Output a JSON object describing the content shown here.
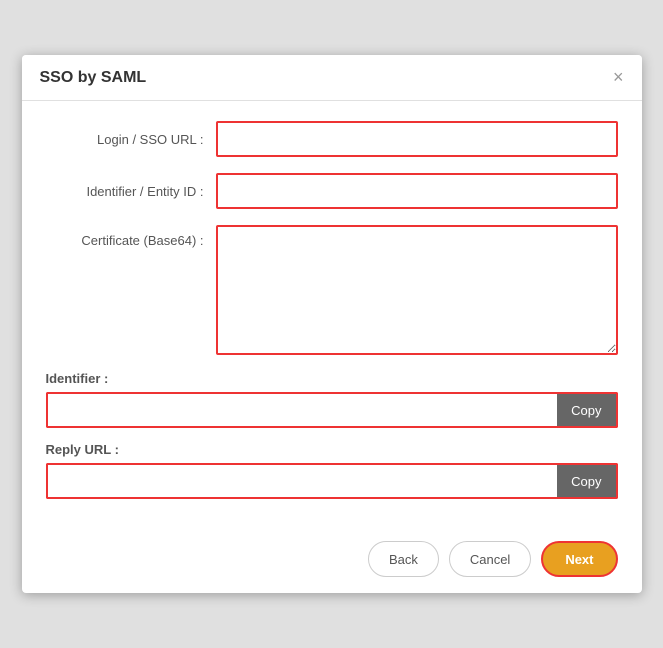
{
  "dialog": {
    "title": "SSO by SAML",
    "close_label": "×"
  },
  "form": {
    "login_sso_url_label": "Login / SSO URL :",
    "login_sso_url_value": "",
    "identifier_entity_id_label": "Identifier / Entity ID :",
    "identifier_entity_id_value": "",
    "certificate_label": "Certificate (Base64) :",
    "certificate_value": "",
    "identifier_section_label": "Identifier :",
    "identifier_copy_value": "",
    "reply_url_section_label": "Reply URL :",
    "reply_url_copy_value": ""
  },
  "buttons": {
    "copy1_label": "Copy",
    "copy2_label": "Copy",
    "back_label": "Back",
    "cancel_label": "Cancel",
    "next_label": "Next"
  }
}
